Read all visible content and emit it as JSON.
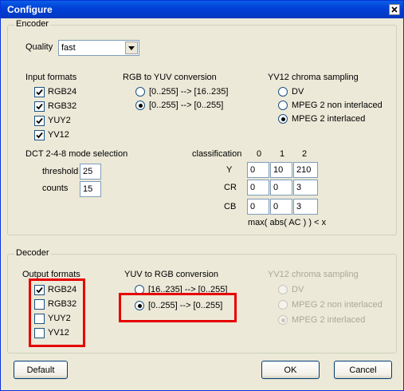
{
  "window": {
    "title": "Configure"
  },
  "encoder": {
    "group_title": "Encoder",
    "quality_label": "Quality",
    "quality_value": "fast",
    "input_formats_title": "Input formats",
    "input_formats": [
      {
        "label": "RGB24",
        "checked": true
      },
      {
        "label": "RGB32",
        "checked": true
      },
      {
        "label": "YUY2",
        "checked": true
      },
      {
        "label": "YV12",
        "checked": true
      }
    ],
    "rgb_to_yuv_title": "RGB to YUV conversion",
    "rgb_to_yuv_options": [
      {
        "label": "[0..255] --> [16..235]",
        "selected": false
      },
      {
        "label": "[0..255] --> [0..255]",
        "selected": true
      }
    ],
    "chroma_title": "YV12 chroma sampling",
    "chroma_options": [
      {
        "label": "DV",
        "selected": false
      },
      {
        "label": "MPEG 2 non interlaced",
        "selected": false
      },
      {
        "label": "MPEG 2 interlaced",
        "selected": true
      }
    ],
    "dct_title": "DCT 2-4-8 mode selection",
    "threshold_label": "threshold",
    "threshold_value": "25",
    "counts_label": "counts",
    "counts_value": "15",
    "classification_label": "classification",
    "class_headers": [
      "0",
      "1",
      "2"
    ],
    "rows": [
      {
        "label": "Y",
        "values": [
          "0",
          "10",
          "210"
        ]
      },
      {
        "label": "CR",
        "values": [
          "0",
          "0",
          "3"
        ]
      },
      {
        "label": "CB",
        "values": [
          "0",
          "0",
          "3"
        ]
      }
    ],
    "formula": "max( abs( AC ) ) < x"
  },
  "decoder": {
    "group_title": "Decoder",
    "output_formats_title": "Output formats",
    "output_formats": [
      {
        "label": "RGB24",
        "checked": true
      },
      {
        "label": "RGB32",
        "checked": false
      },
      {
        "label": "YUY2",
        "checked": false
      },
      {
        "label": "YV12",
        "checked": false
      }
    ],
    "yuv_to_rgb_title": "YUV to RGB conversion",
    "yuv_to_rgb_options": [
      {
        "label": "[16..235] --> [0..255]",
        "selected": false
      },
      {
        "label": "[0..255] --> [0..255]",
        "selected": true
      }
    ],
    "chroma_title": "YV12 chroma sampling",
    "chroma_options": [
      {
        "label": "DV",
        "selected": false
      },
      {
        "label": "MPEG 2 non interlaced",
        "selected": false
      },
      {
        "label": "MPEG 2 interlaced",
        "selected": true
      }
    ]
  },
  "buttons": {
    "default": "Default",
    "ok": "OK",
    "cancel": "Cancel"
  },
  "colors": {
    "title_bar": "#0041d8",
    "highlight_box": "#e60000",
    "dialog_bg": "#ece9d8"
  },
  "icons": {
    "close": "close-icon",
    "dropdown": "chevron-down-icon",
    "check": "checkmark-icon"
  }
}
